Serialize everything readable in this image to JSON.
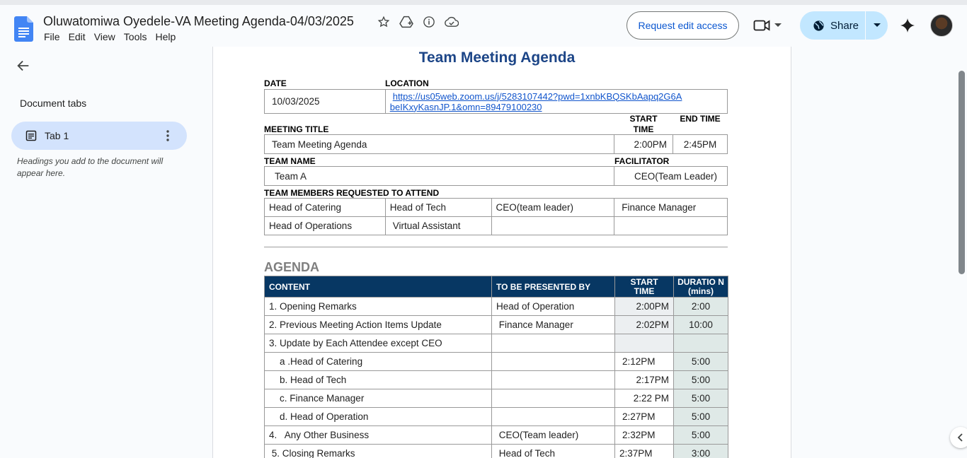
{
  "app": {
    "doc_title": "Oluwatomiwa Oyedele-VA Meeting Agenda-04/03/2025",
    "menu": [
      "File",
      "Edit",
      "View",
      "Tools",
      "Help"
    ],
    "request_edit_label": "Request edit access",
    "share_label": "Share",
    "accent": "#0b57d0",
    "share_bg": "#c2e7ff"
  },
  "sidebar": {
    "heading": "Document tabs",
    "tab_label": "Tab 1",
    "hint": "Headings you add to the document will appear here."
  },
  "doc": {
    "title": "Team Meeting Agenda",
    "title_color": "#1c4587",
    "date_label": "DATE",
    "location_label": "LOCATION",
    "date_value": "10/03/2025",
    "location_link": "https://us05web.zoom.us/j/5283107442?pwd=1xnbKBQSKbAapq2G6AbeIKxyKasnJP.1&omn=89479100230",
    "location_line1": "https://us05web.zoom.us/j/5283107442?pwd=1xnbKBQSKbAapq2G6A",
    "location_line2": "beIKxyKasnJP.1&omn=89479100230",
    "meeting_title_label": "MEETING TITLE",
    "start_time_label": "START TIME",
    "end_time_label": "END TIME",
    "meeting_title_value": "Team Meeting Agenda",
    "start_time_value": "2:00PM",
    "end_time_value": "2:45PM",
    "team_name_label": "TEAM NAME",
    "facilitator_label": "FACILITATOR",
    "team_name_value": "Team A",
    "facilitator_value": "CEO(Team Leader)",
    "members_label": "TEAM MEMBERS REQUESTED TO ATTEND",
    "members": [
      [
        "Head of Catering",
        "Head of Tech",
        "CEO(team leader)",
        "Finance Manager"
      ],
      [
        "Head of Operations",
        "Virtual Assistant",
        "",
        ""
      ]
    ],
    "agenda_heading": "AGENDA",
    "agenda_header": {
      "content": "CONTENT",
      "presenter": "TO BE PRESENTED BY",
      "start": "START TIME",
      "duration": "DURATIO N(mins)"
    },
    "agenda_rows": [
      {
        "content": "1. Opening Remarks",
        "presenter": "Head of Operation",
        "start": "2:00PM",
        "duration": "2:00"
      },
      {
        "content": "2.  Previous Meeting Action Items Update",
        "presenter": " Finance Manager",
        "start": "2:02PM",
        "duration": "10:00"
      },
      {
        "content": "3. Update by Each Attendee except CEO",
        "presenter": "",
        "start": "",
        "duration": ""
      },
      {
        "content": "    a .Head of Catering",
        "presenter": "",
        "start": "2:12PM",
        "duration": "5:00"
      },
      {
        "content": "    b. Head of Tech",
        "presenter": "",
        "start": "2:17PM",
        "duration": "5:00"
      },
      {
        "content": "    c. Finance Manager",
        "presenter": "",
        "start": "2:22 PM",
        "duration": "5:00"
      },
      {
        "content": "    d. Head of Operation",
        "presenter": "",
        "start": "2:27PM",
        "duration": "5:00"
      },
      {
        "content": "4.   Any Other Business",
        "presenter": " CEO(Team leader)",
        "start": "2:32PM",
        "duration": "5:00"
      },
      {
        "content": " 5. Closing Remarks",
        "presenter": " Head of Tech",
        "start": "2:37PM",
        "duration": "3:00"
      }
    ]
  }
}
